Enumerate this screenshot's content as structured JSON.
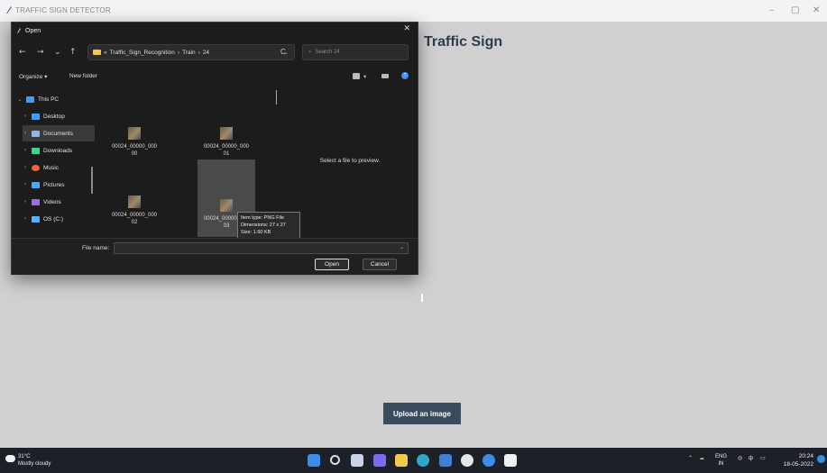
{
  "app": {
    "title": "TRAFFIC SIGN DETECTOR",
    "heading": "Traffic Sign",
    "upload_button": "Upload an image",
    "window_controls": {
      "minimize": "–",
      "maximize": "▢",
      "close": "✕"
    }
  },
  "dialog": {
    "title": "Open",
    "close": "✕",
    "nav": {
      "back": "←",
      "forward": "→",
      "recent": "⌄",
      "up": "↑"
    },
    "breadcrumb": [
      "Traffic_Sign_Recognition",
      "Train",
      "24"
    ],
    "breadcrumb_sep": "›",
    "breadcrumb_prefix": "«",
    "refresh": "C",
    "search_placeholder": "Search 24",
    "toolbar": {
      "organize": "Organize ▾",
      "new_folder": "New folder"
    },
    "sidebar": [
      {
        "label": "This PC",
        "icon": "pc-icon",
        "color": "#3aa0ff"
      },
      {
        "label": "Desktop",
        "icon": "desktop-icon",
        "color": "#3aa0ff"
      },
      {
        "label": "Documents",
        "icon": "documents-icon",
        "color": "#8fb4e8"
      },
      {
        "label": "Downloads",
        "icon": "downloads-icon",
        "color": "#3dd68c"
      },
      {
        "label": "Music",
        "icon": "music-icon",
        "color": "#f0643c"
      },
      {
        "label": "Pictures",
        "icon": "pictures-icon",
        "color": "#4aa8f0"
      },
      {
        "label": "Videos",
        "icon": "videos-icon",
        "color": "#9b6cf0"
      },
      {
        "label": "OS (C:)",
        "icon": "drive-icon",
        "color": "#5ab0ff"
      }
    ],
    "files": [
      {
        "name_line1": "00024_00000_000",
        "name_line2": "00"
      },
      {
        "name_line1": "00024_00000_000",
        "name_line2": "01"
      },
      {
        "name_line1": "00024_00000_000",
        "name_line2": "02"
      },
      {
        "name_line1": "00024_00000_000",
        "name_line2": "03"
      }
    ],
    "preview_text": "Select a file to preview.",
    "tooltip": {
      "type": "Item type: PNG File",
      "dimensions": "Dimensions: 27 x 27",
      "size": "Size: 1.60 KB"
    },
    "file_name_label": "File name:",
    "file_name_value": "",
    "open_button": "Open",
    "cancel_button": "Cancel"
  },
  "taskbar": {
    "temperature": "31°C",
    "weather": "Mostly cloudy",
    "language": "ENG",
    "region": "IN",
    "time": "20:24",
    "date": "18-05-2022"
  }
}
